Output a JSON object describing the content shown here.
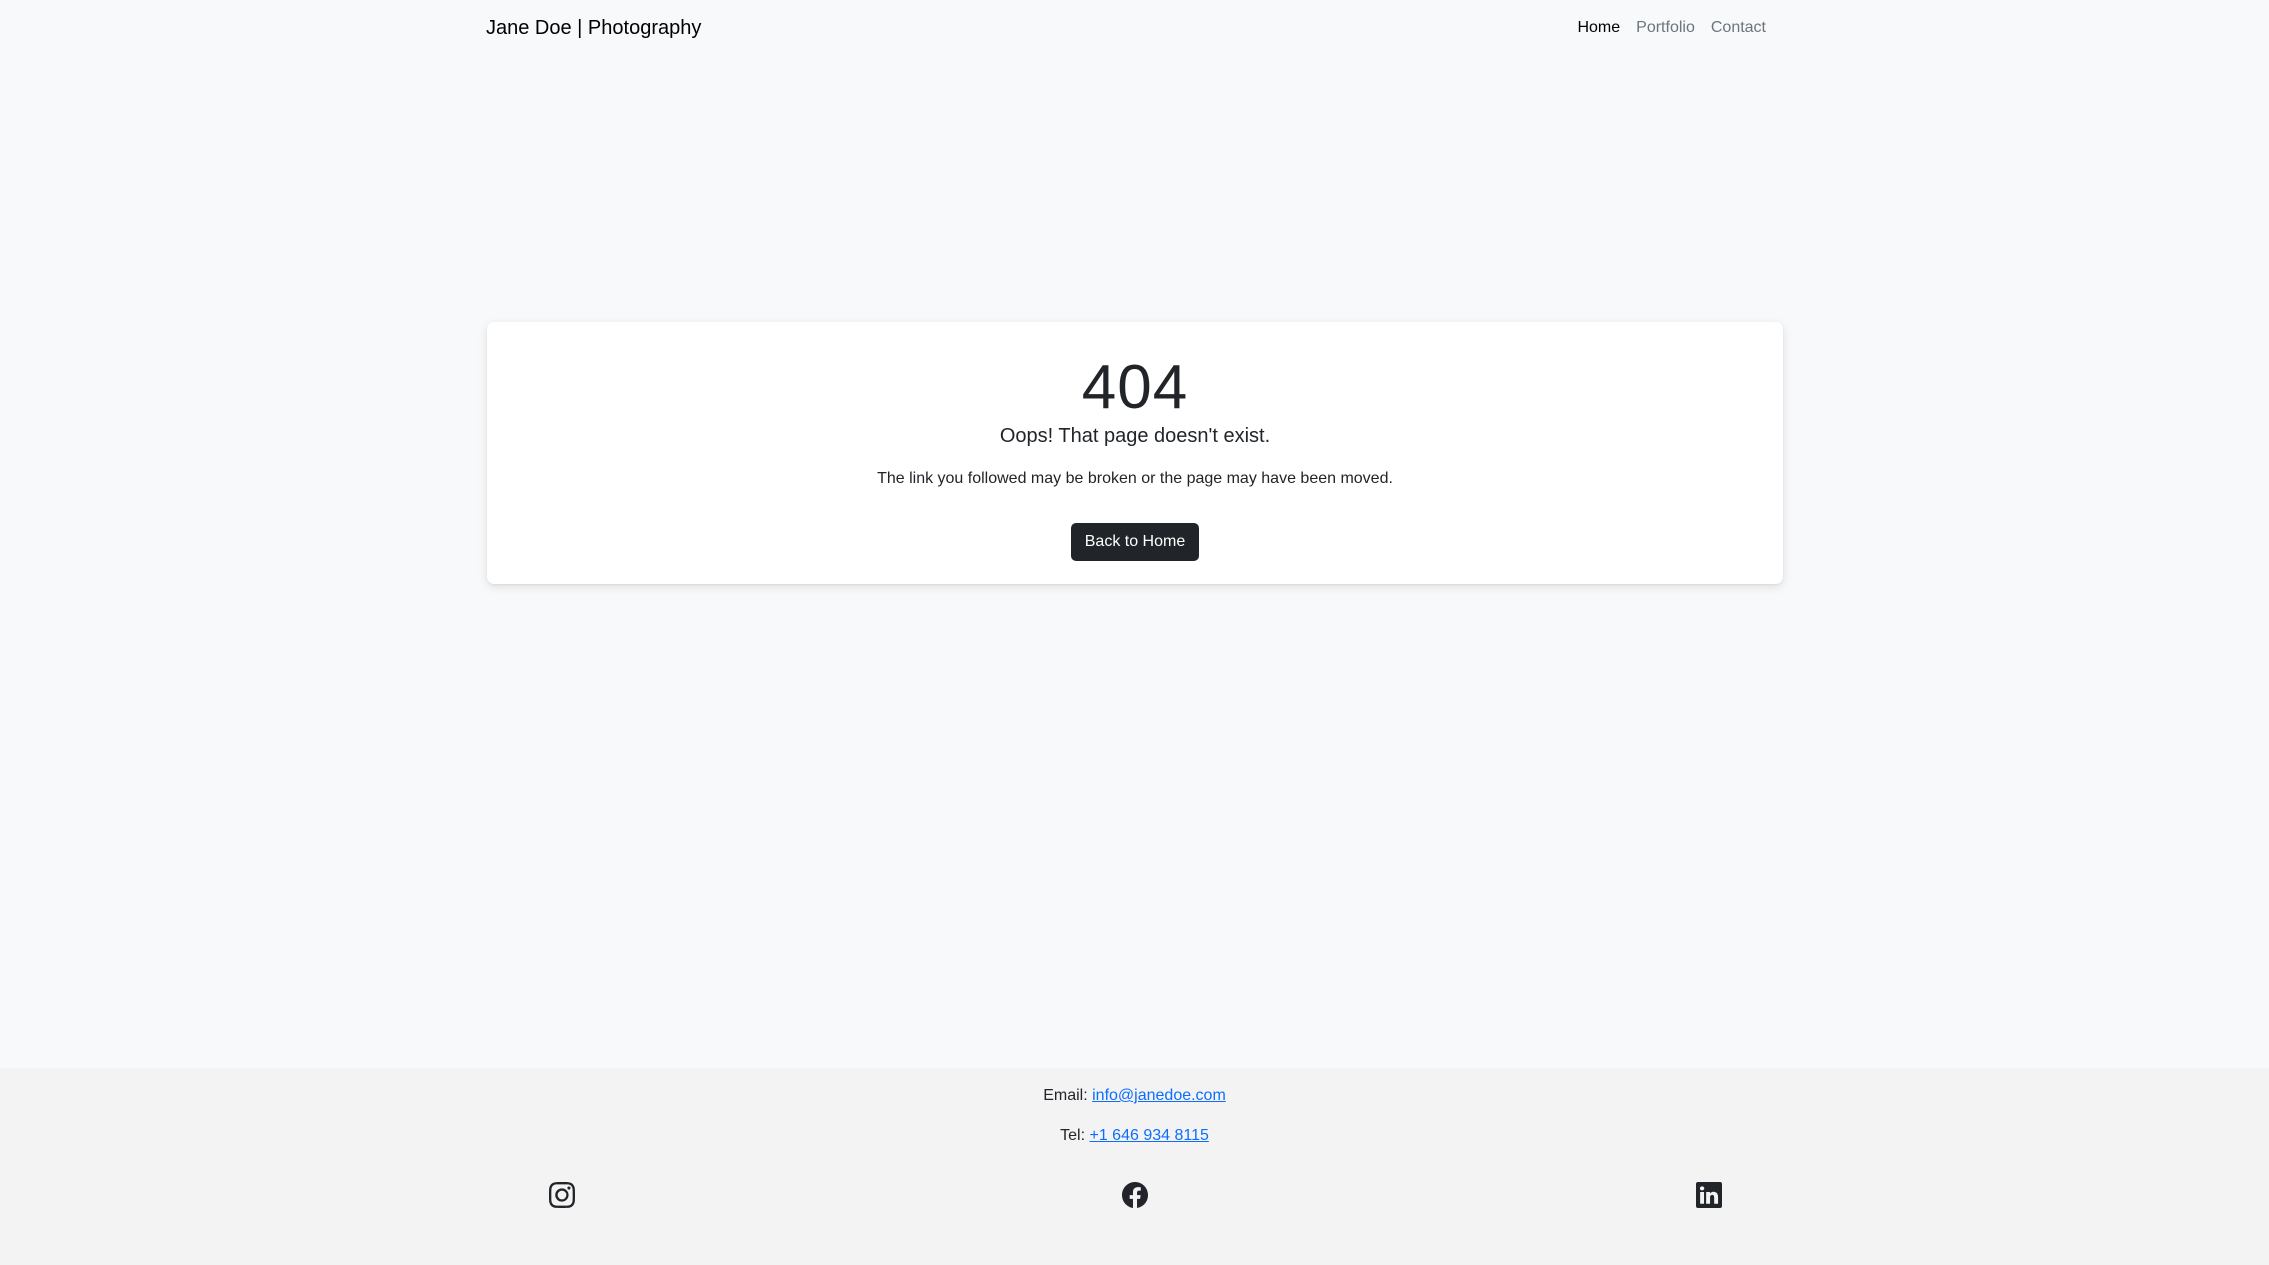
{
  "navbar": {
    "brand": "Jane Doe | Photography",
    "links": [
      {
        "label": "Home",
        "active": true
      },
      {
        "label": "Portfolio",
        "active": false
      },
      {
        "label": "Contact",
        "active": false
      }
    ]
  },
  "error": {
    "code": "404",
    "title": "Oops! That page doesn't exist.",
    "description": "The link you followed may be broken or the page may have been moved.",
    "button_label": "Back to Home"
  },
  "footer": {
    "email_label": "Email:",
    "email": "info@janedoe.com",
    "tel_label": "Tel:",
    "tel": "+1 646 934 8115",
    "social": [
      "instagram-icon",
      "facebook-icon",
      "linkedin-icon"
    ]
  },
  "colors": {
    "background": "#f8f9fa",
    "footer_background": "#f3f3f4",
    "button": "#212529",
    "link": "#0d6efd"
  }
}
